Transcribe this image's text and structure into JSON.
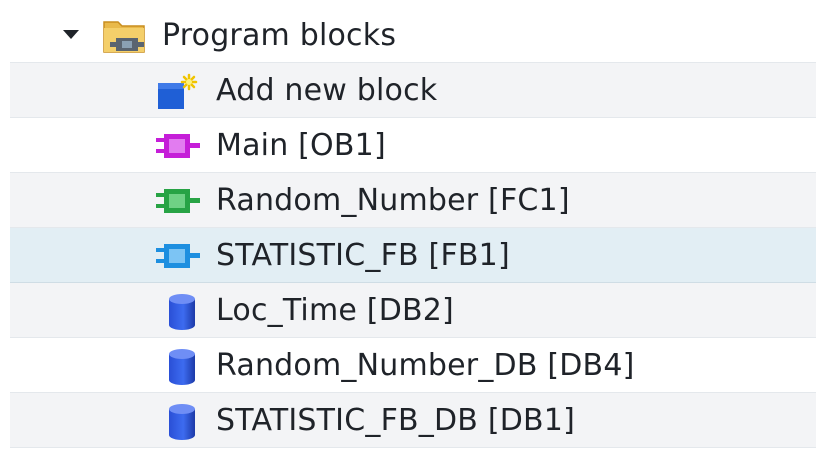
{
  "tree": {
    "root": {
      "label": "Program blocks",
      "icon": "folder-blocks-icon",
      "expanded": true
    },
    "items": [
      {
        "label": "Add new block",
        "icon": "add-new-block-icon"
      },
      {
        "label": "Main [OB1]",
        "icon": "ob-block-icon",
        "color": "#c51ed8"
      },
      {
        "label": "Random_Number [FC1]",
        "icon": "fc-block-icon",
        "color": "#27a345"
      },
      {
        "label": "STATISTIC_FB [FB1]",
        "icon": "fb-block-icon",
        "color": "#1d8fe0",
        "selected": true
      },
      {
        "label": "Loc_Time [DB2]",
        "icon": "db-block-icon",
        "color": "#2a4fd6"
      },
      {
        "label": "Random_Number_DB [DB4]",
        "icon": "db-block-icon",
        "color": "#2a4fd6"
      },
      {
        "label": "STATISTIC_FB_DB [DB1]",
        "icon": "db-block-icon",
        "color": "#2a4fd6"
      }
    ]
  }
}
